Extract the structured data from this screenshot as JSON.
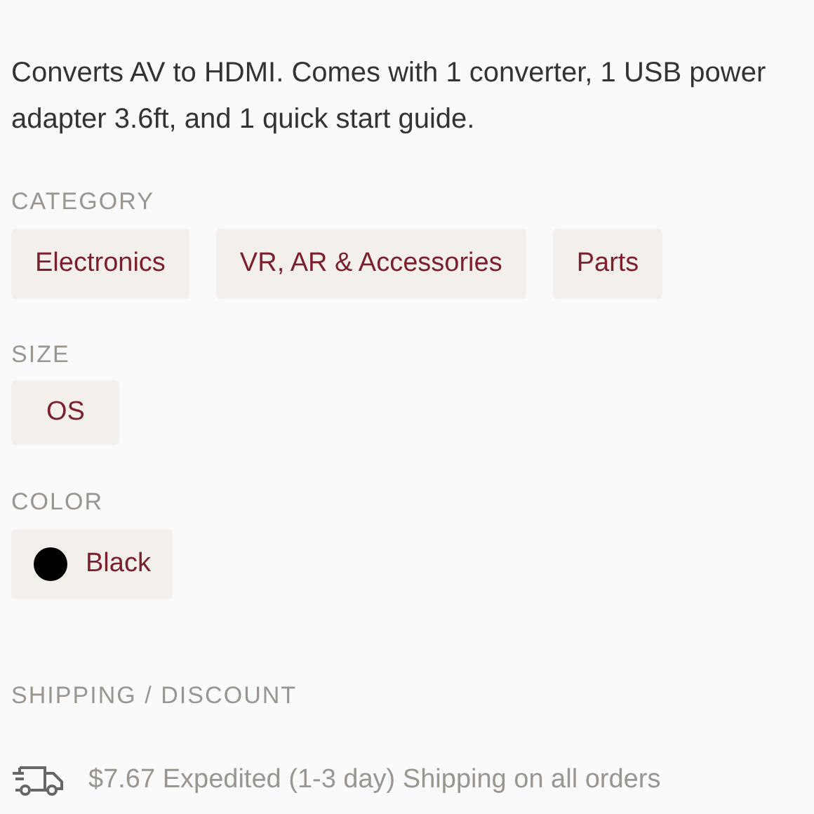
{
  "description": "Converts AV to HDMI. Comes with 1 converter, 1 USB power adapter 3.6ft, and 1 quick start guide.",
  "category": {
    "label": "CATEGORY",
    "tags": [
      "Electronics",
      "VR, AR & Accessories",
      "Parts"
    ]
  },
  "size": {
    "label": "SIZE",
    "value": "OS"
  },
  "color": {
    "label": "COLOR",
    "value": "Black",
    "color": "#000000"
  },
  "shipping": {
    "label": "SHIPPING / DISCOUNT",
    "text": "$7.67 Expedited (1-3 day) Shipping on all orders"
  }
}
